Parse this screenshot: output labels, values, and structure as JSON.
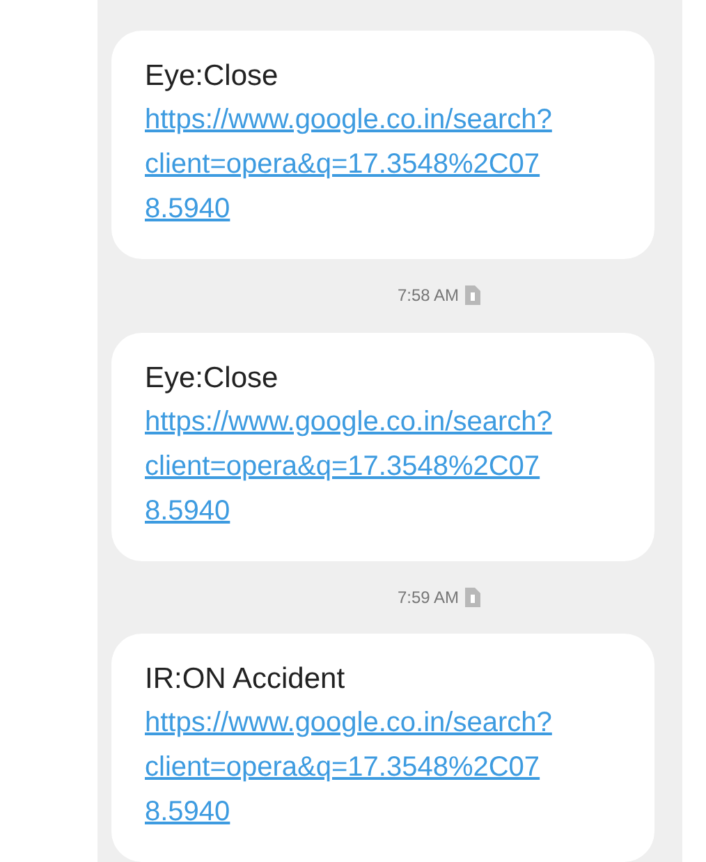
{
  "messages": [
    {
      "text": "Eye:Close",
      "link": "https://www.google.co.in/search?client=opera&q=17.3548%2C078.5940"
    },
    {
      "time": "7:58 AM",
      "text": "Eye:Close",
      "link": "https://www.google.co.in/search?client=opera&q=17.3548%2C078.5940"
    },
    {
      "time": "7:59 AM",
      "text": "IR:ON Accident",
      "link": "https://www.google.co.in/search?client=opera&q=17.3548%2C078.5940"
    }
  ]
}
